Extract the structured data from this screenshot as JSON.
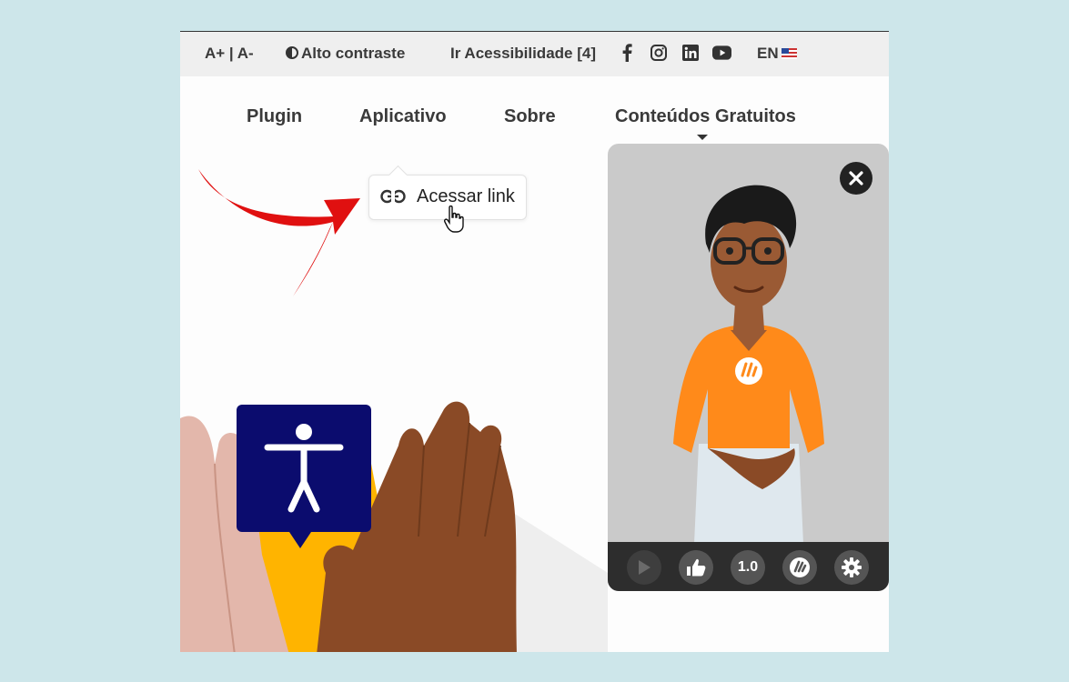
{
  "topbar": {
    "font_size": "A+ | A-",
    "contrast": "Alto contraste",
    "accessibility": "Ir Acessibilidade [4]",
    "social_icons": [
      "facebook-icon",
      "instagram-icon",
      "linkedin-icon",
      "youtube-icon"
    ],
    "language": "EN"
  },
  "nav": {
    "items": [
      {
        "label": "Plugin"
      },
      {
        "label": "Aplicativo"
      },
      {
        "label": "Sobre"
      },
      {
        "label": "Conteúdos Gratuitos"
      }
    ]
  },
  "tooltip": {
    "label": "Acessar link",
    "icon": "link-icon"
  },
  "player": {
    "speed_label": "1.0",
    "controls": [
      "play-icon",
      "thumbs-up-icon",
      "speed",
      "hand-logo-icon",
      "gear-icon"
    ]
  },
  "colors": {
    "background": "#cde6ea",
    "accent_orange": "#ff8a1a",
    "accessibility_blue": "#0b0c6e",
    "yellow": "#ffb400",
    "arrow_red": "#e01010"
  }
}
